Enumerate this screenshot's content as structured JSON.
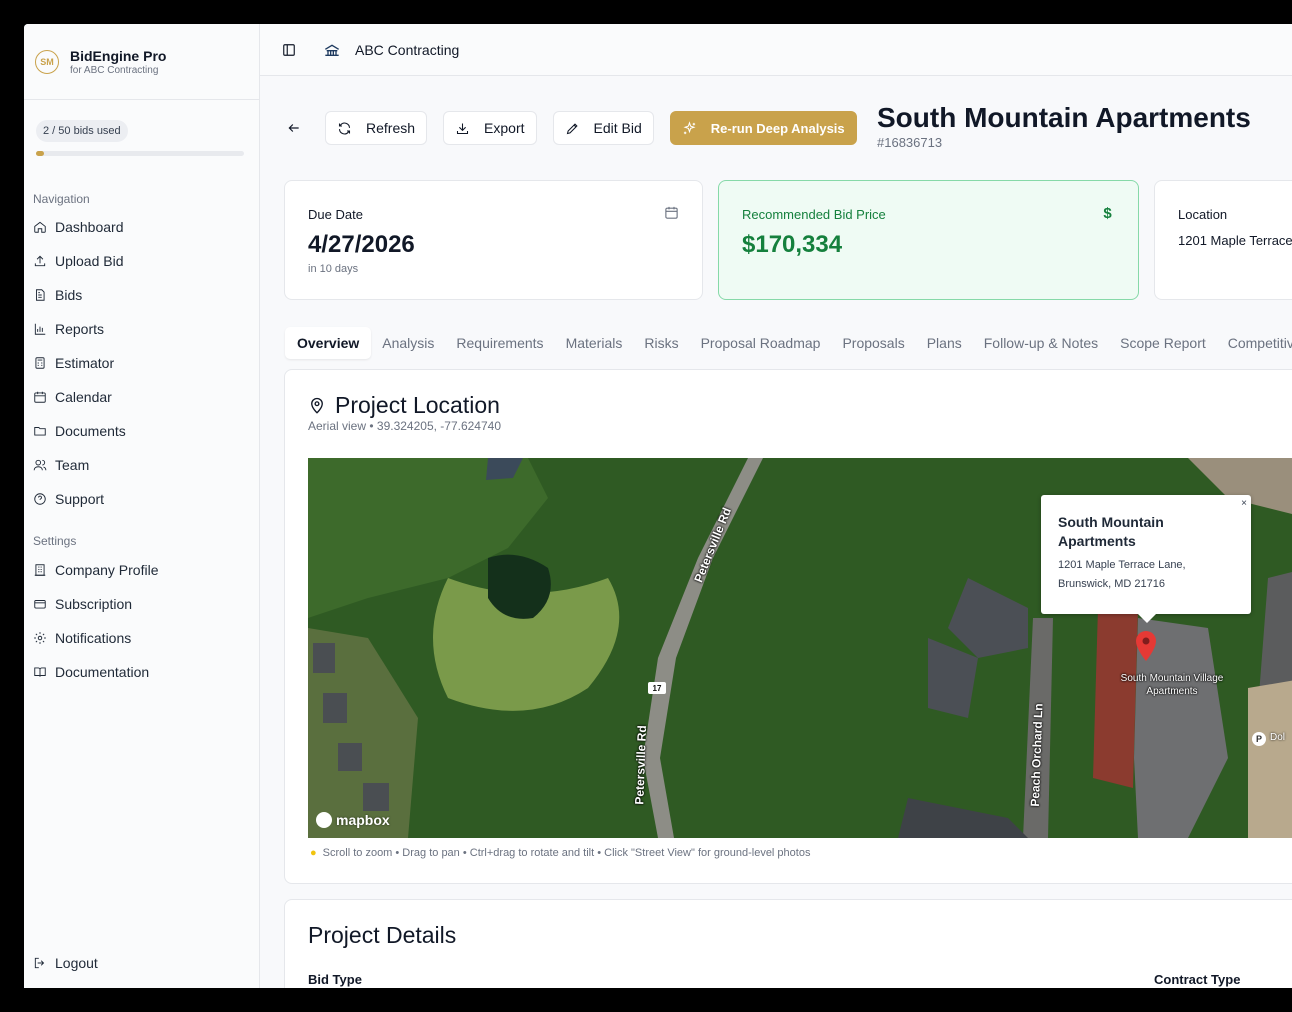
{
  "brand": {
    "name": "BidEngine Pro",
    "subtitle": "for ABC Contracting",
    "logo_text": "SM"
  },
  "usage": {
    "label": "2 / 50 bids used",
    "used": 2,
    "total": 50
  },
  "nav": {
    "section_label": "Navigation",
    "items": [
      {
        "label": "Dashboard",
        "icon": "home-icon"
      },
      {
        "label": "Upload Bid",
        "icon": "upload-icon"
      },
      {
        "label": "Bids",
        "icon": "file-icon"
      },
      {
        "label": "Reports",
        "icon": "bar-chart-icon"
      },
      {
        "label": "Estimator",
        "icon": "calculator-icon"
      },
      {
        "label": "Calendar",
        "icon": "calendar-icon"
      },
      {
        "label": "Documents",
        "icon": "folder-icon"
      },
      {
        "label": "Team",
        "icon": "users-icon"
      },
      {
        "label": "Support",
        "icon": "help-circle-icon"
      }
    ]
  },
  "settings": {
    "section_label": "Settings",
    "items": [
      {
        "label": "Company Profile",
        "icon": "building-icon"
      },
      {
        "label": "Subscription",
        "icon": "credit-card-icon"
      },
      {
        "label": "Notifications",
        "icon": "gear-icon"
      },
      {
        "label": "Documentation",
        "icon": "book-icon"
      }
    ]
  },
  "logout": {
    "label": "Logout"
  },
  "topbar": {
    "org_name": "ABC Contracting"
  },
  "actions": {
    "refresh": "Refresh",
    "export": "Export",
    "edit": "Edit Bid",
    "rerun": "Re-run Deep Analysis"
  },
  "project": {
    "title": "South Mountain Apartments",
    "id": "#16836713"
  },
  "stats": {
    "due": {
      "label": "Due Date",
      "value": "4/27/2026",
      "sub": "in 10 days"
    },
    "price": {
      "label": "Recommended Bid Price",
      "value": "$170,334",
      "icon_glyph": "$"
    },
    "location": {
      "label": "Location",
      "value": "1201 Maple Terrace"
    }
  },
  "tabs": [
    "Overview",
    "Analysis",
    "Requirements",
    "Materials",
    "Risks",
    "Proposal Roadmap",
    "Proposals",
    "Plans",
    "Follow-up & Notes",
    "Scope Report",
    "Competitive Int"
  ],
  "active_tab": "Overview",
  "map_section": {
    "title": "Project Location",
    "subtitle": "Aerial view • 39.324205, -77.624740",
    "popup_title": "South Mountain Apartments",
    "popup_address": "1201 Maple Terrace Lane, Brunswick, MD 21716",
    "popup_close": "×",
    "road_1": "Petersville Rd",
    "road_2": "Petersville Rd",
    "road_3": "Peach Orchard Ln",
    "route_number": "17",
    "poi_name": "South Mountain Village Apartments",
    "poi_p": "P",
    "poi_dol": "Dol",
    "provider": "mapbox",
    "hint": "Scroll to zoom • Drag to pan • Ctrl+drag to rotate and tilt • Click \"Street View\" for ground-level photos",
    "colors": {
      "forest": "#2f5a23",
      "grass": "#7a9a4a",
      "road": "#8d8d86",
      "pin": "#e53935"
    }
  },
  "details": {
    "title": "Project Details",
    "bid_type_label": "Bid Type",
    "contract_type_label": "Contract Type"
  },
  "colors": {
    "accent_gold": "#c9a24b",
    "success_green": "#15803d"
  }
}
